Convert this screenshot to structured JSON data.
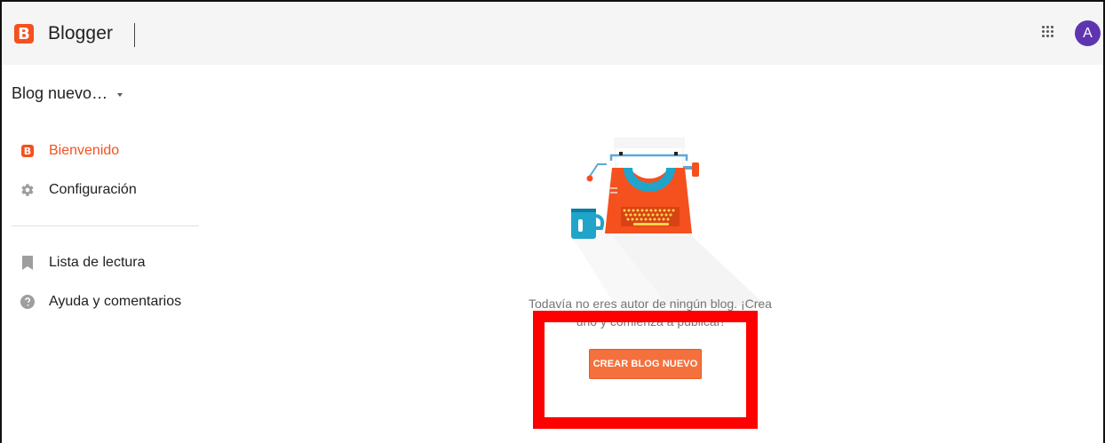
{
  "header": {
    "logo_letter": "B",
    "brand": "Blogger",
    "avatar_letter": "A"
  },
  "sidebar": {
    "blog_selector": "Blog nuevo…",
    "items": [
      {
        "label": "Bienvenido",
        "icon": "blogger-icon",
        "active": true
      },
      {
        "label": "Configuración",
        "icon": "gear-icon"
      },
      {
        "label": "Lista de lectura",
        "icon": "bookmark-icon"
      },
      {
        "label": "Ayuda y comentarios",
        "icon": "help-icon"
      }
    ]
  },
  "main": {
    "empty_message": "Todavía no eres autor de ningún blog. ¡Crea uno y comienza a publicar!",
    "create_button": "CREAR BLOG NUEVO"
  },
  "colors": {
    "accent": "#f4511e",
    "button": "#f4713e",
    "avatar": "#5e35b1",
    "highlight": "#ff0000"
  }
}
